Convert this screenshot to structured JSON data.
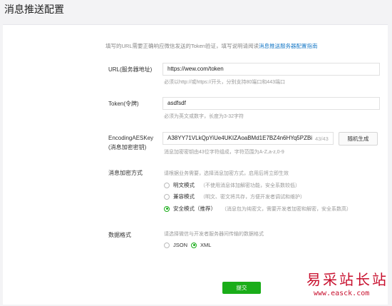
{
  "page_title": "消息推送配置",
  "intro": {
    "text": "填写的URL需要正确响应微信发送的Token验证，填写说明请阅读",
    "link": "消息推送服务器配置指南"
  },
  "url_field": {
    "label": "URL(服务器地址)",
    "value": "https://wew.com/token",
    "hint": "必须以http://或https://开头，分别支持80端口和443端口"
  },
  "token_field": {
    "label": "Token(令牌)",
    "value": "asdfsdf",
    "hint": "必须为英文或数字，长度为3-32字符"
  },
  "aeskey_field": {
    "label_line1": "EncodingAESKey",
    "label_line2": "(消息加密密钥)",
    "value": "A38YY71VLkQpYiUe4UKIZAoaBMd1E7BZ4n6HYq5PZBi",
    "counter": "43/43",
    "generate_button": "随机生成",
    "hint": "消息加密密钥由43位字符组成，字符范围为A-Z,a-z,0-9"
  },
  "encrypt_mode": {
    "label": "消息加密方式",
    "hint": "请根据业务需要，选择消息加密方式，启用后将立即生效",
    "options": [
      {
        "label": "明文模式",
        "desc": "（不使用消息体加解密功能，安全系数较低）",
        "selected": false
      },
      {
        "label": "兼容模式",
        "desc": "（明文、密文将共存，方便开发者调试和维护）",
        "selected": false
      },
      {
        "label": "安全模式（推荐）",
        "desc": "（消息包为纯密文，需要开发者加密和解密，安全系数高）",
        "selected": true
      }
    ]
  },
  "data_format": {
    "label": "数据格式",
    "hint": "请选择微信与开发者服务器间传输的数据格式",
    "options": [
      {
        "label": "JSON",
        "selected": false
      },
      {
        "label": "XML",
        "selected": true
      }
    ]
  },
  "submit_label": "提交",
  "watermark": {
    "cn": "易采站长站",
    "url": "www.easck.com"
  },
  "colors": {
    "accent": "#1aad19",
    "link": "#1a7ac7",
    "watermark": "#c8102e"
  }
}
